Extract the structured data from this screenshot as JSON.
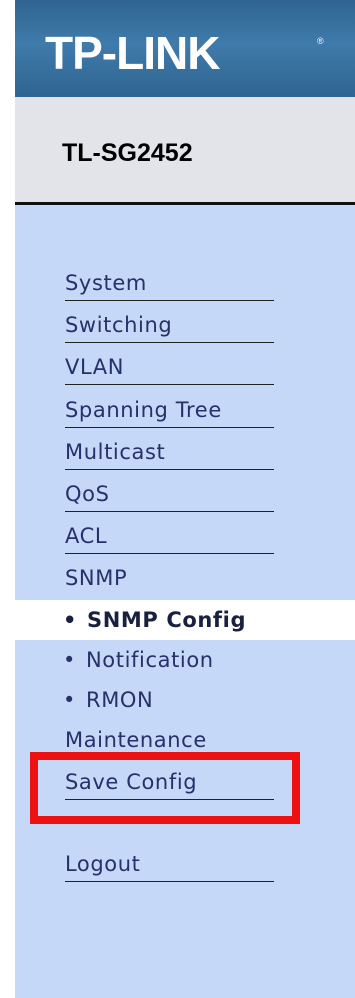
{
  "brand": {
    "logo": "TP-LINK",
    "registered": "®"
  },
  "model": "TL-SG2452",
  "menu": {
    "system": "System",
    "switching": "Switching",
    "vlan": "VLAN",
    "spanning_tree": "Spanning Tree",
    "multicast": "Multicast",
    "qos": "QoS",
    "acl": "ACL",
    "snmp": "SNMP",
    "maintenance": "Maintenance",
    "save_config": "Save Config",
    "logout": "Logout"
  },
  "submenu": {
    "bullet": "•",
    "snmp_config": "SNMP Config",
    "notification": "Notification",
    "rmon": "RMON"
  },
  "colors": {
    "panel": "#c5d8f7",
    "logo_bar": "#3f7bab",
    "highlight": "#ee1111"
  }
}
